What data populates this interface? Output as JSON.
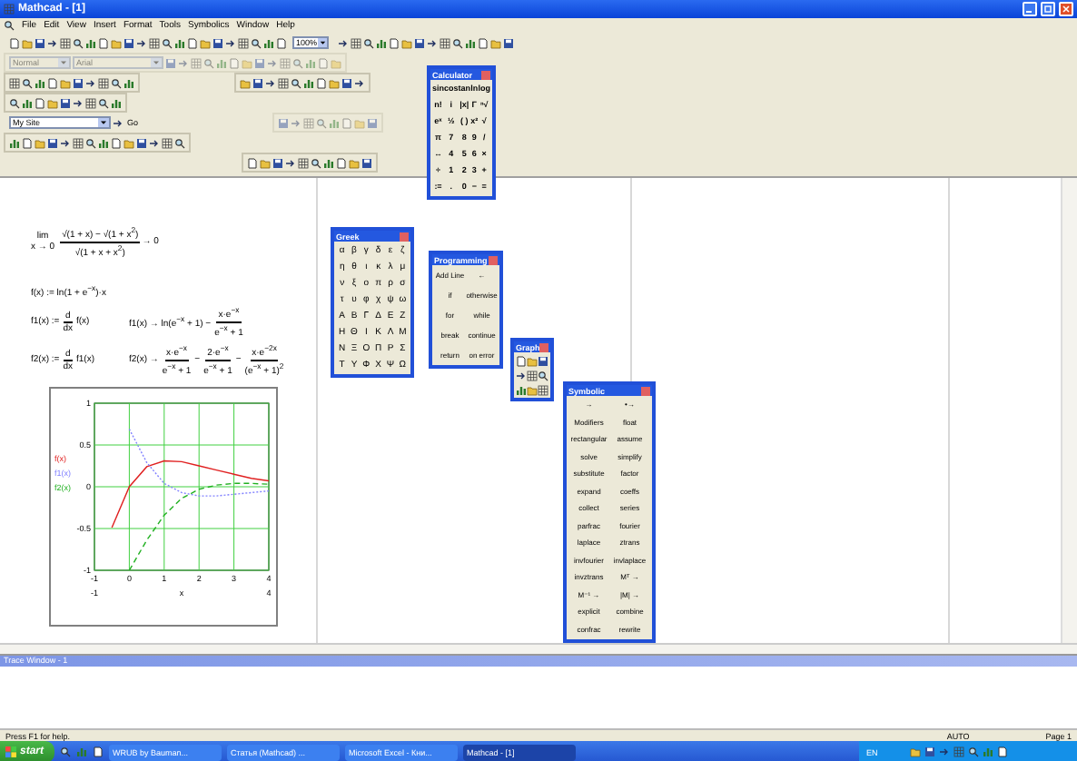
{
  "window": {
    "title": "Mathcad - [1]"
  },
  "menu": [
    "File",
    "Edit",
    "View",
    "Insert",
    "Format",
    "Tools",
    "Symbolics",
    "Window",
    "Help"
  ],
  "toolbar": {
    "zoom": "100%",
    "style": "Normal",
    "font": "Arial",
    "site": "My Site",
    "go": "Go"
  },
  "worksheet": {
    "rows": [
      [
        {
          "parts": [
            {
              "kind": "limit",
              "text": "lim",
              "sub": "x → 0"
            },
            {
              "kind": "frac",
              "num": "√(1 + x) − √(1 + x$^{2}$)",
              "den": "√(1 + x + x$^{2}$)"
            },
            {
              "kind": "text",
              "text": "→ 0"
            }
          ]
        }
      ],
      [
        {
          "parts": [
            {
              "kind": "text",
              "text": "f(x) := ln(1 + e$^{−x}$)·x"
            }
          ]
        }
      ],
      [
        {
          "parts": [
            {
              "kind": "text",
              "text": "f1(x) :="
            },
            {
              "kind": "frac",
              "num": "d",
              "den": "dx"
            },
            {
              "kind": "text",
              "text": "f(x)"
            }
          ]
        },
        {
          "parts": [
            {
              "kind": "text",
              "text": "f1(x) → ln(e$^{−x}$ + 1) −"
            },
            {
              "kind": "frac",
              "num": "x·e$^{−x}$",
              "den": "e$^{−x}$ + 1"
            }
          ]
        }
      ],
      [
        {
          "parts": [
            {
              "kind": "text",
              "text": "f2(x) :="
            },
            {
              "kind": "frac",
              "num": "d",
              "den": "dx"
            },
            {
              "kind": "text",
              "text": "f1(x)"
            }
          ]
        },
        {
          "parts": [
            {
              "kind": "text",
              "text": "f2(x) →"
            },
            {
              "kind": "frac",
              "num": "x·e$^{−x}$",
              "den": "e$^{−x}$ + 1"
            },
            {
              "kind": "text",
              "text": "−"
            },
            {
              "kind": "frac",
              "num": "2·e$^{−x}$",
              "den": "e$^{−x}$ + 1"
            },
            {
              "kind": "text",
              "text": "−"
            },
            {
              "kind": "frac",
              "num": "x·e$^{−2x}$",
              "den": "(e$^{−x}$ + 1)$^{2}$"
            }
          ]
        }
      ]
    ],
    "plot": {
      "x_range": [
        "-1",
        "4"
      ],
      "chart_data": {
        "type": "line",
        "xlabel": "x",
        "grid": true,
        "legend": true,
        "x": [
          -0.5,
          0,
          0.5,
          1,
          1.5,
          2,
          2.5,
          3,
          3.5,
          4
        ],
        "xlim": [
          -1,
          4
        ],
        "ylim": [
          -1,
          1
        ],
        "xticks": [
          -1,
          0,
          1,
          2,
          3,
          4
        ],
        "yticks": [
          -1,
          -0.5,
          0,
          0.5,
          1
        ],
        "series": [
          {
            "name": "f(x)",
            "color": "#e02020",
            "line_style": "solid",
            "values": [
              -0.49,
              0,
              0.24,
              0.31,
              0.3,
              0.25,
              0.2,
              0.15,
              0.1,
              0.07
            ]
          },
          {
            "name": "f1(x)",
            "color": "#8080ff",
            "line_style": "dotted",
            "values": [
              null,
              0.69,
              0.29,
              0.04,
              -0.07,
              -0.11,
              -0.11,
              -0.09,
              -0.07,
              -0.05
            ]
          },
          {
            "name": "f2(x)",
            "color": "#20b020",
            "line_style": "dashed",
            "values": [
              null,
              -1,
              -0.64,
              -0.34,
              -0.14,
              -0.03,
              0.02,
              0.04,
              0.04,
              0.03
            ]
          }
        ]
      }
    }
  },
  "palettes": [
    {
      "kind": "calculator",
      "title": "Calculator",
      "keys": [
        "sin",
        "cos",
        "tan",
        "ln",
        "log",
        "n!",
        "i",
        "|x|",
        "Γ",
        "ⁿ√",
        "eˣ",
        "½",
        "( )",
        "x²",
        "√",
        "π",
        "7",
        "8",
        "9",
        "/",
        "↔",
        "4",
        "5",
        "6",
        "×",
        "÷",
        "1",
        "2",
        "3",
        "+",
        ":=",
        ".",
        "0",
        "−",
        "="
      ]
    },
    {
      "kind": "greek",
      "title": "Greek",
      "keys": [
        "α",
        "β",
        "γ",
        "δ",
        "ε",
        "ζ",
        "η",
        "θ",
        "ι",
        "κ",
        "λ",
        "μ",
        "ν",
        "ξ",
        "ο",
        "π",
        "ρ",
        "σ",
        "τ",
        "υ",
        "φ",
        "χ",
        "ψ",
        "ω",
        "Α",
        "Β",
        "Γ",
        "Δ",
        "Ε",
        "Ζ",
        "Η",
        "Θ",
        "Ι",
        "Κ",
        "Λ",
        "Μ",
        "Ν",
        "Ξ",
        "Ο",
        "Π",
        "Ρ",
        "Σ",
        "Τ",
        "Υ",
        "Φ",
        "Χ",
        "Ψ",
        "Ω"
      ]
    },
    {
      "kind": "programming",
      "title": "Programming",
      "keys": [
        "Add Line",
        "←",
        "if",
        "otherwise",
        "for",
        "while",
        "break",
        "continue",
        "return",
        "on error"
      ]
    },
    {
      "kind": "graph",
      "title": "Graph"
    },
    {
      "kind": "symbolic",
      "title": "Symbolic",
      "keys": [
        "→",
        "•→",
        "Modifiers",
        "float",
        "rectangular",
        "assume",
        "solve",
        "simplify",
        "substitute",
        "factor",
        "expand",
        "coeffs",
        "collect",
        "series",
        "parfrac",
        "fourier",
        "laplace",
        "ztrans",
        "invfourier",
        "invlaplace",
        "invztrans",
        "Mᵀ →",
        "M⁻¹ →",
        "|M| →",
        "explicit",
        "combine",
        "confrac",
        "rewrite"
      ]
    }
  ],
  "trace_window": {
    "title": "Trace Window - 1"
  },
  "status_bar": [
    "Press F1 for help.",
    "AUTO",
    "Page 1"
  ],
  "taskbar": {
    "start": "start",
    "tasks": [
      {
        "label": "WRUB by Bauman...",
        "selected": false
      },
      {
        "label": "Статья (Mathcad) ...",
        "selected": false
      },
      {
        "label": "Microsoft Excel - Кни...",
        "selected": false
      },
      {
        "label": "Mathcad - [1]",
        "selected": true
      }
    ],
    "language": "EN"
  }
}
